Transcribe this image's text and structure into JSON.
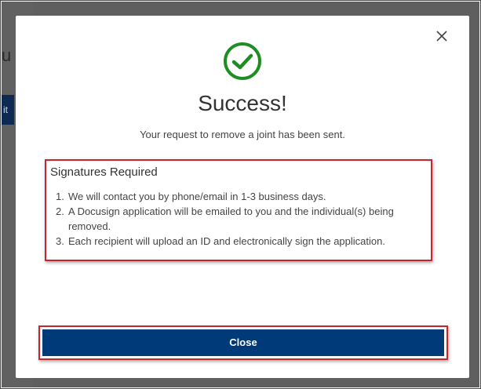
{
  "background": {
    "fragment_text": "u",
    "fragment_button": "it"
  },
  "modal": {
    "close_icon": "close-icon",
    "success_icon": "check-circle-icon",
    "title": "Success!",
    "subtitle": "Your request to remove a joint has been sent.",
    "signatures": {
      "heading": "Signatures Required",
      "items": [
        {
          "number": "1.",
          "text": "We will contact you by phone/email in 1-3 business days."
        },
        {
          "number": "2.",
          "text": "A Docusign application will be emailed to you and the individual(s) being removed."
        },
        {
          "number": "3.",
          "text": "Each recipient will upload an ID and electronically sign the application."
        }
      ]
    },
    "close_button_label": "Close"
  },
  "colors": {
    "success_green": "#1e8e23",
    "highlight_red": "#c9252c",
    "button_blue": "#003a78",
    "backdrop": "#5f5f5f"
  }
}
